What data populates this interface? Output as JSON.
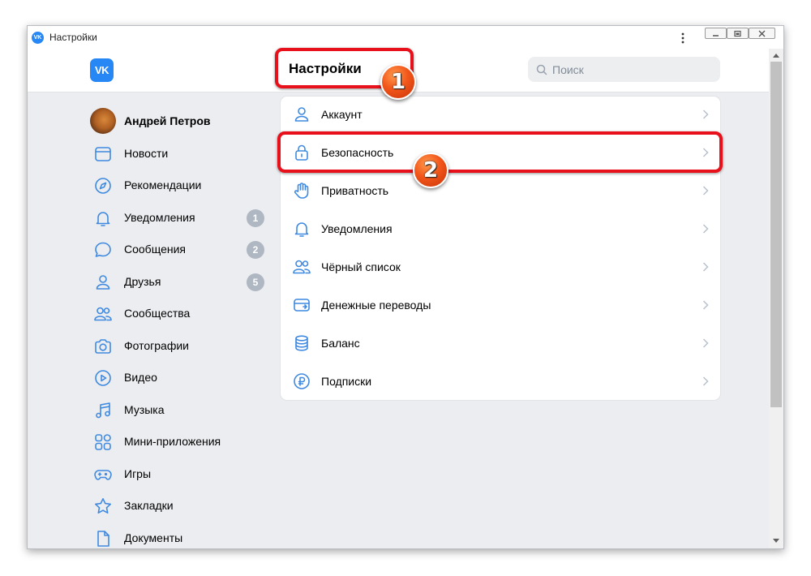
{
  "window": {
    "title": "Настройки",
    "logo_text": "VK"
  },
  "header": {
    "logo_text": "VK",
    "title": "Настройки",
    "search_placeholder": "Поиск"
  },
  "sidebar": {
    "profile_name": "Андрей Петров",
    "items": [
      {
        "label": "Новости",
        "icon": "newspaper-icon"
      },
      {
        "label": "Рекомендации",
        "icon": "compass-icon"
      },
      {
        "label": "Уведомления",
        "icon": "bell-icon",
        "count": "1"
      },
      {
        "label": "Сообщения",
        "icon": "message-icon",
        "count": "2"
      },
      {
        "label": "Друзья",
        "icon": "user-icon",
        "count": "5"
      },
      {
        "label": "Сообщества",
        "icon": "users-icon"
      },
      {
        "label": "Фотографии",
        "icon": "camera-icon"
      },
      {
        "label": "Видео",
        "icon": "play-icon"
      },
      {
        "label": "Музыка",
        "icon": "music-icon"
      },
      {
        "label": "Мини-приложения",
        "icon": "apps-icon"
      },
      {
        "label": "Игры",
        "icon": "gamepad-icon"
      },
      {
        "label": "Закладки",
        "icon": "star-icon"
      },
      {
        "label": "Документы",
        "icon": "document-icon"
      }
    ]
  },
  "settings": {
    "items": [
      {
        "label": "Аккаунт",
        "icon": "user-icon"
      },
      {
        "label": "Безопасность",
        "icon": "lock-icon"
      },
      {
        "label": "Приватность",
        "icon": "hand-icon"
      },
      {
        "label": "Уведомления",
        "icon": "bell-icon"
      },
      {
        "label": "Чёрный список",
        "icon": "users-icon"
      },
      {
        "label": "Денежные переводы",
        "icon": "card-icon"
      },
      {
        "label": "Баланс",
        "icon": "coins-icon"
      },
      {
        "label": "Подписки",
        "icon": "ruble-icon"
      }
    ]
  },
  "annotations": {
    "step1": "1",
    "step2": "2"
  },
  "colors": {
    "accent": "#3f8ae0",
    "brand": "#2787f5",
    "highlight": "#e8101a",
    "badge": "#f2561a",
    "counter": "#aeb7c2"
  }
}
